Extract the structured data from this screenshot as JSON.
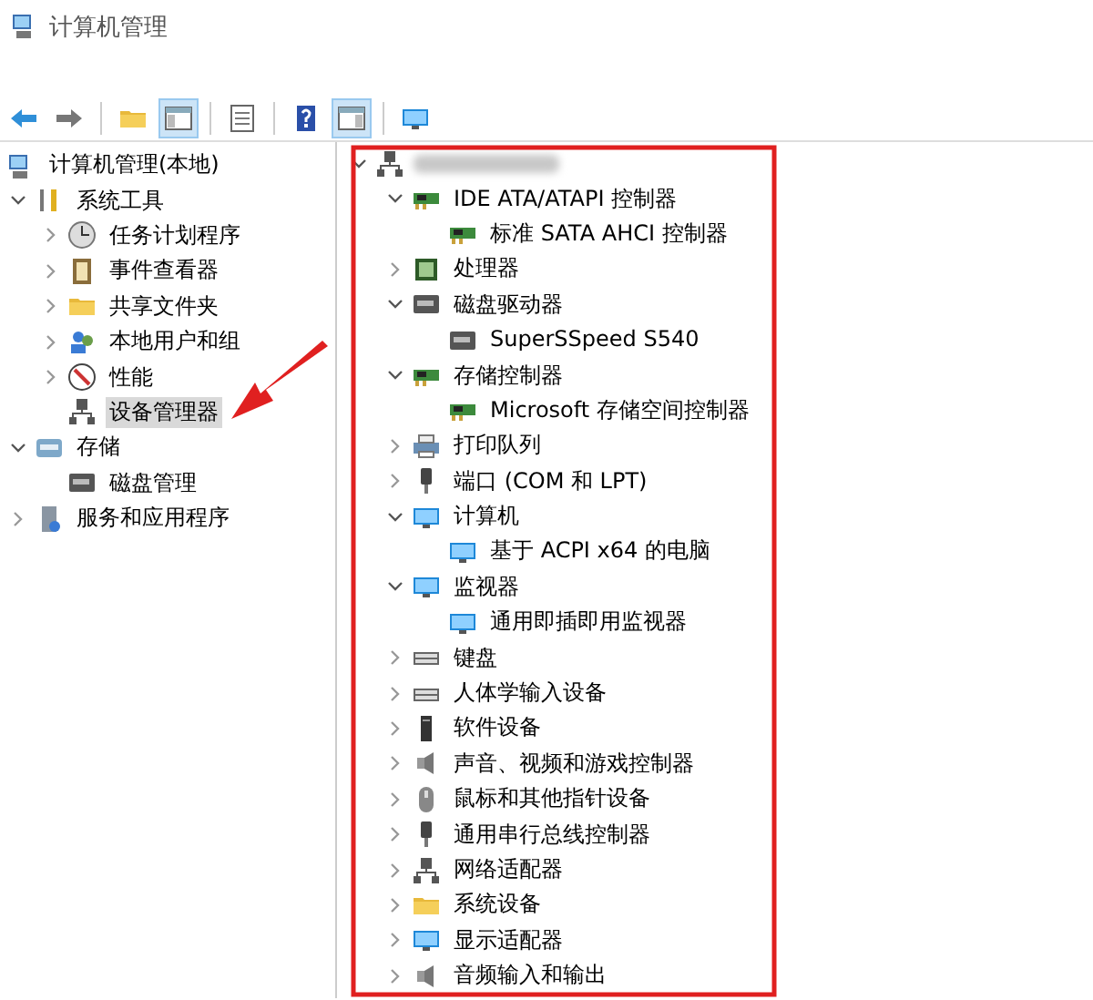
{
  "window": {
    "title": "计算机管理"
  },
  "toolbar": [
    {
      "pressed": false
    },
    {
      "pressed": false
    },
    {
      "pressed": false
    },
    {
      "pressed": true
    },
    {
      "pressed": false
    },
    {
      "pressed": false
    },
    {
      "pressed": true
    },
    {
      "pressed": false
    }
  ],
  "sidebar": {
    "items": [
      {
        "label": "计算机管理(本地)",
        "selected": false,
        "children": [
          {
            "label": "系统工具",
            "expanded": true,
            "selected": false,
            "children": [
              {
                "label": "任务计划程序",
                "expanded": false,
                "selected": false
              },
              {
                "label": "事件查看器",
                "expanded": false,
                "selected": false
              },
              {
                "label": "共享文件夹",
                "expanded": false,
                "selected": false
              },
              {
                "label": "本地用户和组",
                "expanded": false,
                "selected": false
              },
              {
                "label": "性能",
                "expanded": false,
                "selected": false
              },
              {
                "label": "设备管理器",
                "selected": true
              }
            ]
          },
          {
            "label": "存储",
            "expanded": true,
            "selected": false,
            "children": [
              {
                "label": "磁盘管理",
                "selected": false
              }
            ]
          },
          {
            "label": "服务和应用程序",
            "expanded": false,
            "selected": false
          }
        ]
      }
    ]
  },
  "device_tree": {
    "expanded": true,
    "children": [
      {
        "label": "IDE ATA/ATAPI 控制器",
        "expanded": true,
        "children": [
          {
            "label": "标准 SATA AHCI 控制器"
          }
        ]
      },
      {
        "label": "处理器",
        "expanded": false
      },
      {
        "label": "磁盘驱动器",
        "expanded": true,
        "children": [
          {
            "label": "SuperSSpeed S540"
          }
        ]
      },
      {
        "label": "存储控制器",
        "expanded": true,
        "children": [
          {
            "label": "Microsoft 存储空间控制器"
          }
        ]
      },
      {
        "label": "打印队列",
        "expanded": false
      },
      {
        "label": "端口 (COM 和 LPT)",
        "expanded": false
      },
      {
        "label": "计算机",
        "expanded": true,
        "children": [
          {
            "label": "基于 ACPI x64 的电脑"
          }
        ]
      },
      {
        "label": "监视器",
        "expanded": true,
        "children": [
          {
            "label": "通用即插即用监视器"
          }
        ]
      },
      {
        "label": "键盘",
        "expanded": false
      },
      {
        "label": "人体学输入设备",
        "expanded": false
      },
      {
        "label": "软件设备",
        "expanded": false
      },
      {
        "label": "声音、视频和游戏控制器",
        "expanded": false
      },
      {
        "label": "鼠标和其他指针设备",
        "expanded": false
      },
      {
        "label": "通用串行总线控制器",
        "expanded": false
      },
      {
        "label": "网络适配器",
        "expanded": false
      },
      {
        "label": "系统设备",
        "expanded": false
      },
      {
        "label": "显示适配器",
        "expanded": false
      },
      {
        "label": "音频输入和输出",
        "expanded": false
      }
    ]
  }
}
